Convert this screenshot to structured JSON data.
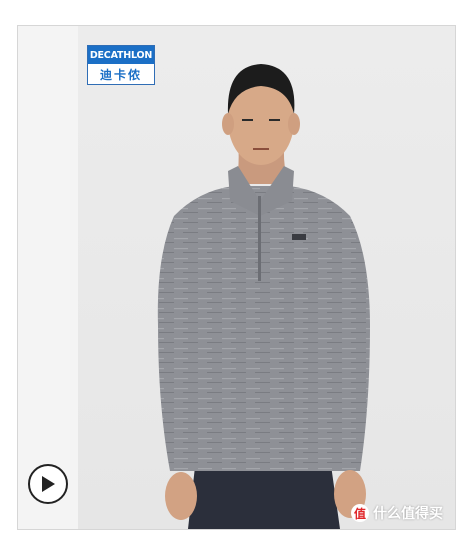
{
  "product_image": {
    "subject": "man in grey half-zip fleece pullover",
    "background_color": "#e8e8e8",
    "garment_color": "#8e9096"
  },
  "brand_logo": {
    "top_text": "DECATHLON",
    "bottom_text": "迪卡侬",
    "brand_color": "#1b6fc6"
  },
  "video_control": {
    "icon": "play-icon"
  },
  "watermark": {
    "badge": "值",
    "text": "什么值得买"
  }
}
